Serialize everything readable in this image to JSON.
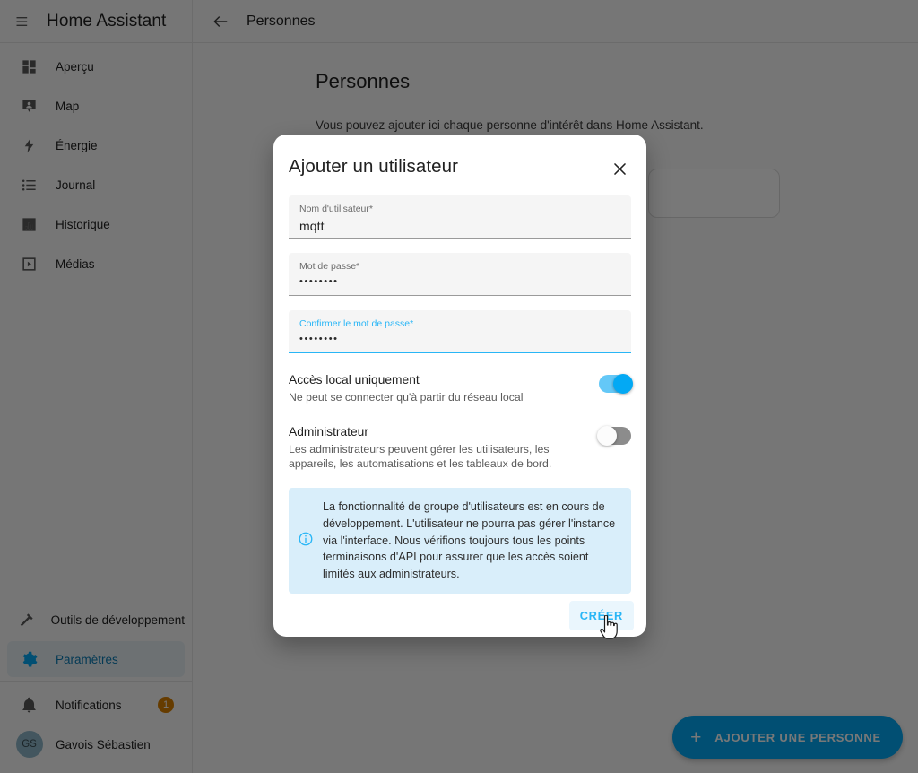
{
  "sidebar": {
    "menu_icon": "menu-collapse-icon",
    "title": "Home Assistant",
    "items": [
      {
        "label": "Aperçu",
        "icon": "view-dashboard-icon",
        "active": false
      },
      {
        "label": "Map",
        "icon": "map-marker-account-icon",
        "active": false
      },
      {
        "label": "Énergie",
        "icon": "lightning-bolt-icon",
        "active": false
      },
      {
        "label": "Journal",
        "icon": "format-list-bulleted-icon",
        "active": false
      },
      {
        "label": "Historique",
        "icon": "chart-box-icon",
        "active": false
      },
      {
        "label": "Médias",
        "icon": "play-box-icon",
        "active": false
      }
    ],
    "bottom_items": [
      {
        "label": "Outils de développement",
        "icon": "hammer-icon",
        "active": false
      },
      {
        "label": "Paramètres",
        "icon": "cog-icon",
        "active": true
      }
    ],
    "notifications": {
      "label": "Notifications",
      "icon": "bell-icon",
      "badge": "1"
    },
    "user": {
      "label": "Gavois Sébastien",
      "initials": "GS"
    }
  },
  "toolbar": {
    "back_icon": "arrow-left-icon",
    "title": "Personnes"
  },
  "page": {
    "title": "Personnes",
    "subtitle": "Vous pouvez ajouter ici chaque personne d'intérêt dans Home Assistant."
  },
  "fab": {
    "icon": "plus-icon",
    "label": "AJOUTER UNE PERSONNE"
  },
  "dialog": {
    "title": "Ajouter un utilisateur",
    "close_icon": "close-icon",
    "fields": [
      {
        "label": "Nom d'utilisateur*",
        "value": "mqtt",
        "focused": false,
        "masked": false
      },
      {
        "label": "Mot de passe*",
        "value": "••••••••",
        "focused": false,
        "masked": true
      },
      {
        "label": "Confirmer le mot de passe*",
        "value": "••••••••",
        "focused": true,
        "masked": true
      }
    ],
    "toggles": [
      {
        "title": "Accès local uniquement",
        "description": "Ne peut se connecter qu'à partir du réseau local",
        "state": "on"
      },
      {
        "title": "Administrateur",
        "description": "Les administrateurs peuvent gérer les utilisateurs, les appareils, les automatisations et les tableaux de bord.",
        "state": "off"
      }
    ],
    "notice": {
      "icon": "information-outline-icon",
      "text": "La fonctionnalité de groupe d'utilisateurs est en cours de développement. L'utilisateur ne pourra pas gérer l'instance via l'interface. Nous vérifions toujours tous les points terminaisons d'API pour assurer que les accès soient limités aux administrateurs."
    },
    "create_button": "CRÉER"
  },
  "colors": {
    "accent": "#03a9f4",
    "accent_light": "#29b6f6",
    "badge": "#d98100",
    "notice_bg": "#d9eefa",
    "avatar_bg": "#8eb8c9"
  }
}
